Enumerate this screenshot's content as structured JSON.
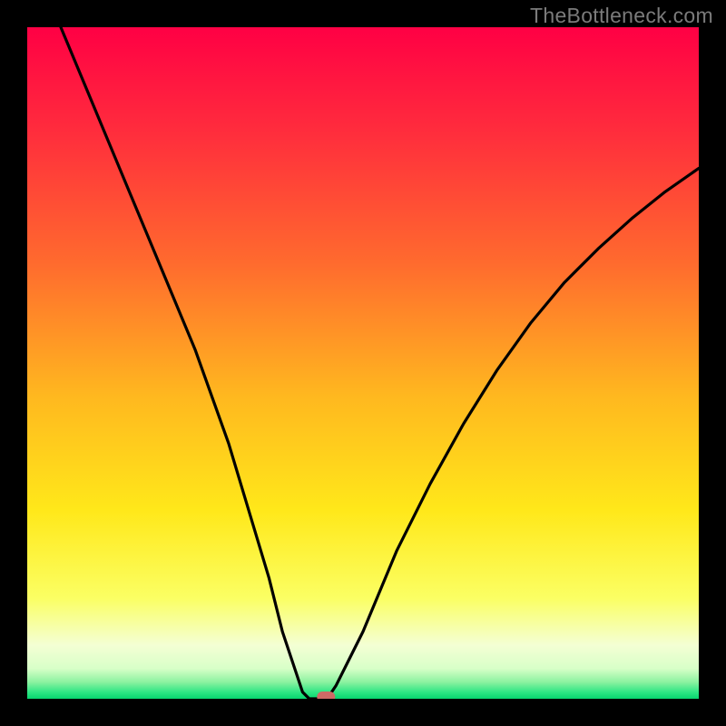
{
  "watermark": "TheBottleneck.com",
  "chart_data": {
    "type": "line",
    "title": "",
    "xlabel": "",
    "ylabel": "",
    "xlim": [
      0,
      100
    ],
    "ylim": [
      0,
      100
    ],
    "series": [
      {
        "name": "curve",
        "x": [
          5,
          10,
          15,
          20,
          25,
          30,
          33,
          36,
          38,
          40,
          41,
          42,
          43,
          44,
          45,
          46,
          50,
          55,
          60,
          65,
          70,
          75,
          80,
          85,
          90,
          95,
          100
        ],
        "y": [
          100,
          88,
          76,
          64,
          52,
          38,
          28,
          18,
          10,
          4,
          1,
          0,
          0,
          0,
          0.5,
          2,
          10,
          22,
          32,
          41,
          49,
          56,
          62,
          67,
          71.5,
          75.5,
          79
        ]
      }
    ],
    "marker": {
      "x": 44.5,
      "y": 0
    },
    "gradient_stops": [
      {
        "offset": 0.0,
        "color": "#ff0044"
      },
      {
        "offset": 0.15,
        "color": "#ff2b3d"
      },
      {
        "offset": 0.35,
        "color": "#ff6a2e"
      },
      {
        "offset": 0.55,
        "color": "#ffb81f"
      },
      {
        "offset": 0.72,
        "color": "#ffe81a"
      },
      {
        "offset": 0.85,
        "color": "#fbff63"
      },
      {
        "offset": 0.92,
        "color": "#f4ffd4"
      },
      {
        "offset": 0.955,
        "color": "#d8ffc8"
      },
      {
        "offset": 0.975,
        "color": "#8cf2a0"
      },
      {
        "offset": 0.99,
        "color": "#2fe684"
      },
      {
        "offset": 1.0,
        "color": "#07d56e"
      }
    ],
    "marker_color": "#cf6a66",
    "curve_color": "#000000"
  }
}
